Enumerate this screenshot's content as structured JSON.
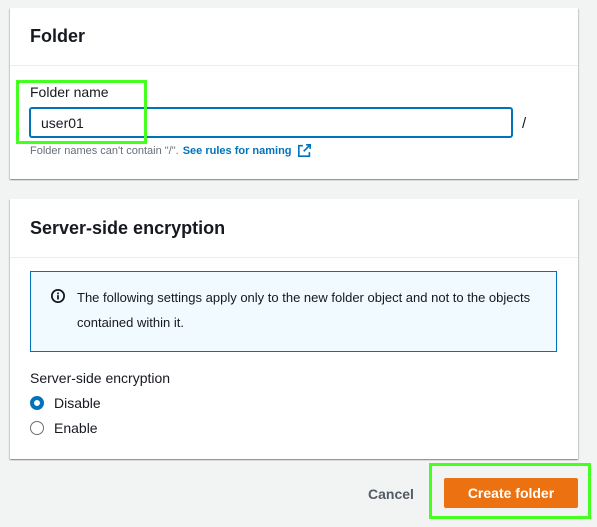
{
  "folder_panel": {
    "title": "Folder",
    "field_label": "Folder name",
    "input_value": "user01",
    "slash": "/",
    "hint_text": "Folder names can't contain \"/\".",
    "hint_link": "See rules for naming"
  },
  "encryption_panel": {
    "title": "Server-side encryption",
    "info_text": "The following settings apply only to the new folder object and not to the objects contained within it.",
    "field_label": "Server-side encryption",
    "options": [
      {
        "label": "Disable",
        "selected": true
      },
      {
        "label": "Enable",
        "selected": false
      }
    ]
  },
  "footer": {
    "cancel_label": "Cancel",
    "create_label": "Create folder"
  },
  "colors": {
    "primary_button": "#ec7211",
    "link": "#0073bb",
    "highlight": "#44ff1f"
  },
  "icons": [
    "external-link-icon",
    "info-icon"
  ]
}
